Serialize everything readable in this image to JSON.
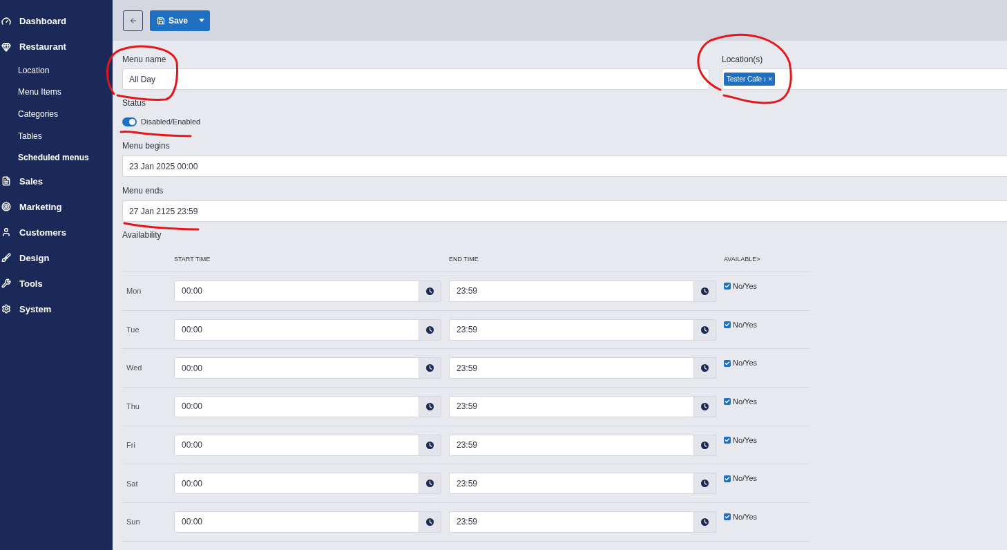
{
  "sidebar": {
    "items": [
      {
        "label": "Dashboard",
        "selected": false
      },
      {
        "label": "Restaurant",
        "selected": false,
        "expanded": true,
        "children": [
          {
            "label": "Location",
            "selected": false
          },
          {
            "label": "Menu Items",
            "selected": false
          },
          {
            "label": "Categories",
            "selected": false
          },
          {
            "label": "Tables",
            "selected": false
          },
          {
            "label": "Scheduled menus",
            "selected": true
          }
        ]
      },
      {
        "label": "Sales",
        "selected": false
      },
      {
        "label": "Marketing",
        "selected": false
      },
      {
        "label": "Customers",
        "selected": false
      },
      {
        "label": "Design",
        "selected": false
      },
      {
        "label": "Tools",
        "selected": false
      },
      {
        "label": "System",
        "selected": false
      }
    ]
  },
  "toolbar": {
    "save_label": "Save"
  },
  "form": {
    "menu_name": {
      "label": "Menu name",
      "value": "All Day"
    },
    "locations": {
      "label": "Location(s)",
      "tags": [
        {
          "text": "Tester Cafe",
          "remove": "×"
        }
      ]
    },
    "status": {
      "label": "Status",
      "toggle_label": "Disabled/Enabled",
      "on": true
    },
    "menu_begins": {
      "label": "Menu begins",
      "value": "23 Jan 2025 00:00"
    },
    "menu_ends": {
      "label": "Menu ends",
      "value": "27 Jan 2125 23:59"
    },
    "availability": {
      "label": "Availability",
      "columns": [
        "START TIME",
        "END TIME",
        "AVAILABLE>"
      ],
      "rows": [
        {
          "day": "Mon",
          "start": "00:00",
          "end": "23:59",
          "available_label": "No/Yes",
          "checked": true
        },
        {
          "day": "Tue",
          "start": "00:00",
          "end": "23:59",
          "available_label": "No/Yes",
          "checked": true
        },
        {
          "day": "Wed",
          "start": "00:00",
          "end": "23:59",
          "available_label": "No/Yes",
          "checked": true
        },
        {
          "day": "Thu",
          "start": "00:00",
          "end": "23:59",
          "available_label": "No/Yes",
          "checked": true
        },
        {
          "day": "Fri",
          "start": "00:00",
          "end": "23:59",
          "available_label": "No/Yes",
          "checked": true
        },
        {
          "day": "Sat",
          "start": "00:00",
          "end": "23:59",
          "available_label": "No/Yes",
          "checked": true
        },
        {
          "day": "Sun",
          "start": "00:00",
          "end": "23:59",
          "available_label": "No/Yes",
          "checked": true
        }
      ]
    }
  }
}
